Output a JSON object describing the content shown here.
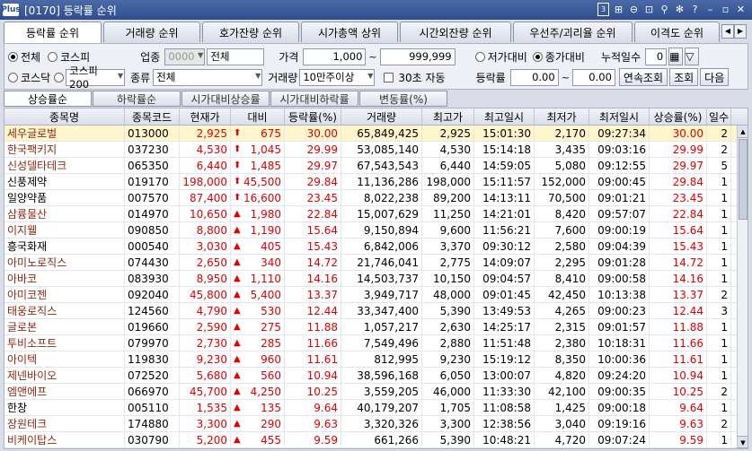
{
  "window": {
    "logo": "Plus",
    "title": "[0170] 등락률 순위",
    "page_box": "3",
    "icons": [
      "page-box-icon",
      "copy-icon",
      "minimize-icon",
      "resize-icon",
      "pin-icon",
      "link-icon",
      "help-icon",
      "window-minimize-icon",
      "window-restore-icon",
      "close-icon"
    ]
  },
  "tabs": [
    "등락률 순위",
    "거래량 순위",
    "호가잔량 순위",
    "시가총액 상위",
    "시간외잔량 순위",
    "우선주/괴리율 순위",
    "이격도 순위"
  ],
  "filters": {
    "market_all": "전체",
    "market_kospi": "코스피",
    "market_kosdaq": "코스닥",
    "index_select": "코스피200",
    "industry_label": "업종",
    "industry_code": "0000",
    "industry_value": "전체",
    "type_label": "종류",
    "type_value": "전체",
    "price_label": "가격",
    "price_from": "1,000",
    "price_to": "999,999",
    "tilde": "~",
    "volume_label": "거래량",
    "volume_value": "10만주이상",
    "auto_label": "30초 자동",
    "low_vs": "저가대비",
    "close_vs": "종가대비",
    "days_label": "누적일수",
    "days_value": "0",
    "rate_label": "등락률",
    "rate_from": "0.00",
    "rate_to": "0.00",
    "continuous_btn": "연속조회",
    "query_btn": "조회",
    "next_btn": "다음"
  },
  "subtabs": [
    "상승률순",
    "하락률순",
    "시가대비상승률",
    "시가대비하락률",
    "변동률(%)"
  ],
  "columns": [
    "종목명",
    "종목코드",
    "현재가",
    "대비",
    "등락률(%)",
    "거래량",
    "최고가",
    "최고일시",
    "최저가",
    "최저일시",
    "상승률(%)",
    "일수"
  ],
  "rows": [
    {
      "name": "세우글로벌",
      "code": "013000",
      "price": "2,925",
      "arrow": "⬆",
      "change": "675",
      "rate": "30.00",
      "volume": "65,849,425",
      "high": "2,925",
      "high_time": "15:01:30",
      "low": "2,170",
      "low_time": "09:27:34",
      "rise": "30.00",
      "days": "2"
    },
    {
      "name": "한국팩키지",
      "code": "037230",
      "price": "4,530",
      "arrow": "⬆",
      "change": "1,045",
      "rate": "29.99",
      "volume": "53,085,140",
      "high": "4,530",
      "high_time": "15:14:18",
      "low": "3,435",
      "low_time": "09:03:16",
      "rise": "29.99",
      "days": "2"
    },
    {
      "name": "신성델타테크",
      "code": "065350",
      "price": "6,440",
      "arrow": "⬆",
      "change": "1,485",
      "rate": "29.97",
      "volume": "67,543,543",
      "high": "6,440",
      "high_time": "14:59:05",
      "low": "5,080",
      "low_time": "09:12:55",
      "rise": "29.97",
      "days": "5"
    },
    {
      "name": "신풍제약",
      "code": "019170",
      "price": "198,000",
      "arrow": "⬆",
      "change": "45,500",
      "rate": "29.84",
      "volume": "11,136,286",
      "high": "198,000",
      "high_time": "15:11:57",
      "low": "152,000",
      "low_time": "09:00:45",
      "rise": "29.84",
      "days": "1"
    },
    {
      "name": "일양약품",
      "code": "007570",
      "price": "87,400",
      "arrow": "⬆",
      "change": "16,600",
      "rate": "23.45",
      "volume": "8,022,238",
      "high": "89,200",
      "high_time": "14:13:11",
      "low": "70,500",
      "low_time": "09:01:21",
      "rise": "23.45",
      "days": "1"
    },
    {
      "name": "삼륭물산",
      "code": "014970",
      "price": "10,650",
      "arrow": "▲",
      "change": "1,980",
      "rate": "22.84",
      "volume": "15,007,629",
      "high": "11,250",
      "high_time": "14:21:01",
      "low": "8,420",
      "low_time": "09:57:07",
      "rise": "22.84",
      "days": "1"
    },
    {
      "name": "이지웰",
      "code": "090850",
      "price": "8,800",
      "arrow": "▲",
      "change": "1,190",
      "rate": "15.64",
      "volume": "9,150,894",
      "high": "9,600",
      "high_time": "11:56:21",
      "low": "7,600",
      "low_time": "09:00:19",
      "rise": "15.64",
      "days": "1"
    },
    {
      "name": "흥국화재",
      "code": "000540",
      "price": "3,030",
      "arrow": "▲",
      "change": "405",
      "rate": "15.43",
      "volume": "6,842,006",
      "high": "3,370",
      "high_time": "09:30:12",
      "low": "2,580",
      "low_time": "09:04:39",
      "rise": "15.43",
      "days": "1"
    },
    {
      "name": "아미노로직스",
      "code": "074430",
      "price": "2,650",
      "arrow": "▲",
      "change": "340",
      "rate": "14.72",
      "volume": "21,746,041",
      "high": "2,775",
      "high_time": "14:09:07",
      "low": "2,295",
      "low_time": "09:01:28",
      "rise": "14.72",
      "days": "1"
    },
    {
      "name": "아바코",
      "code": "083930",
      "price": "8,950",
      "arrow": "▲",
      "change": "1,110",
      "rate": "14.16",
      "volume": "14,503,737",
      "high": "10,150",
      "high_time": "09:04:57",
      "low": "8,410",
      "low_time": "09:00:58",
      "rise": "14.16",
      "days": "1"
    },
    {
      "name": "아미코젠",
      "code": "092040",
      "price": "45,800",
      "arrow": "▲",
      "change": "5,400",
      "rate": "13.37",
      "volume": "3,949,717",
      "high": "48,000",
      "high_time": "09:01:45",
      "low": "42,450",
      "low_time": "10:13:38",
      "rise": "13.37",
      "days": "2"
    },
    {
      "name": "태웅로직스",
      "code": "124560",
      "price": "4,790",
      "arrow": "▲",
      "change": "530",
      "rate": "12.44",
      "volume": "33,347,400",
      "high": "5,390",
      "high_time": "13:49:53",
      "low": "4,265",
      "low_time": "09:00:23",
      "rise": "12.44",
      "days": "3"
    },
    {
      "name": "글로본",
      "code": "019660",
      "price": "2,590",
      "arrow": "▲",
      "change": "275",
      "rate": "11.88",
      "volume": "1,057,217",
      "high": "2,630",
      "high_time": "14:25:17",
      "low": "2,315",
      "low_time": "09:01:57",
      "rise": "11.88",
      "days": "1"
    },
    {
      "name": "투비소프트",
      "code": "079970",
      "price": "2,730",
      "arrow": "▲",
      "change": "285",
      "rate": "11.66",
      "volume": "7,549,496",
      "high": "2,880",
      "high_time": "11:51:48",
      "low": "2,380",
      "low_time": "10:18:31",
      "rise": "11.66",
      "days": "1"
    },
    {
      "name": "아이텍",
      "code": "119830",
      "price": "9,230",
      "arrow": "▲",
      "change": "960",
      "rate": "11.61",
      "volume": "812,995",
      "high": "9,230",
      "high_time": "15:19:12",
      "low": "8,350",
      "low_time": "10:00:36",
      "rise": "11.61",
      "days": "1"
    },
    {
      "name": "제넨바이오",
      "code": "072520",
      "price": "5,680",
      "arrow": "▲",
      "change": "560",
      "rate": "10.94",
      "volume": "38,596,168",
      "high": "6,050",
      "high_time": "13:00:07",
      "low": "4,820",
      "low_time": "09:24:20",
      "rise": "10.94",
      "days": "1"
    },
    {
      "name": "엠앤에프",
      "code": "066970",
      "price": "45,700",
      "arrow": "▲",
      "change": "4,250",
      "rate": "10.25",
      "volume": "3,559,205",
      "high": "46,000",
      "high_time": "11:33:30",
      "low": "42,100",
      "low_time": "09:00:35",
      "rise": "10.25",
      "days": "2"
    },
    {
      "name": "한창",
      "code": "005110",
      "price": "1,535",
      "arrow": "▲",
      "change": "135",
      "rate": "9.64",
      "volume": "40,179,207",
      "high": "1,705",
      "high_time": "11:08:58",
      "low": "1,425",
      "low_time": "09:00:18",
      "rise": "9.64",
      "days": "1"
    },
    {
      "name": "장원테크",
      "code": "174880",
      "price": "3,300",
      "arrow": "▲",
      "change": "290",
      "rate": "9.63",
      "volume": "3,320,326",
      "high": "3,300",
      "high_time": "12:38:56",
      "low": "3,040",
      "low_time": "09:19:16",
      "rise": "9.63",
      "days": "2"
    },
    {
      "name": "비케이탑스",
      "code": "030790",
      "price": "5,200",
      "arrow": "▲",
      "change": "455",
      "rate": "9.59",
      "volume": "661,266",
      "high": "5,390",
      "high_time": "10:48:21",
      "low": "4,720",
      "low_time": "09:07:24",
      "rise": "9.59",
      "days": "1"
    }
  ]
}
